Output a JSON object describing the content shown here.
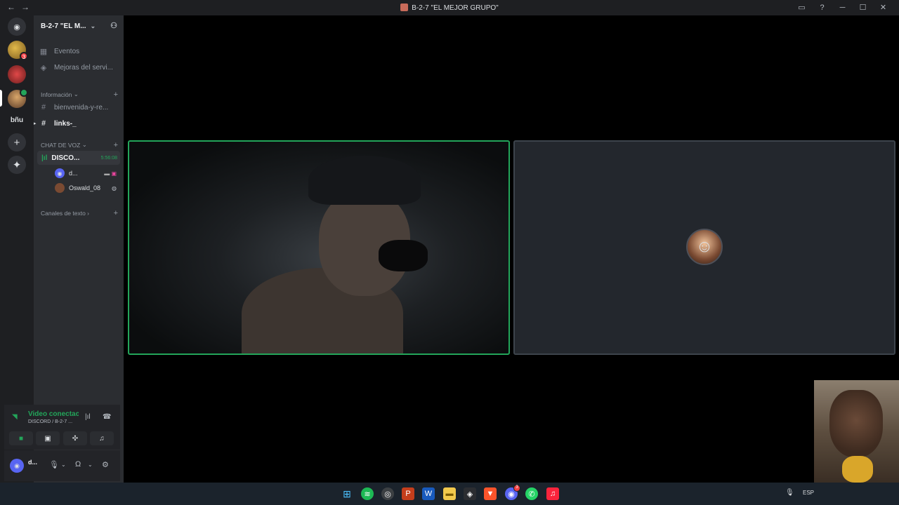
{
  "window": {
    "title": "B-2-7 \"EL MEJOR GRUPO\""
  },
  "servers": {
    "s1_badge": "3",
    "text_server": "bñu"
  },
  "server": {
    "name": "B-2-7 \"EL M..."
  },
  "channels": {
    "events": "Eventos",
    "boosts": "Mejoras del servi...",
    "cat_info": "Información",
    "ch_welcome": "bienvenida-y-re...",
    "ch_links": "links-_",
    "cat_voice": "CHAT DE VOZ",
    "voice_channel": "DISCO...",
    "voice_time": "5:56:08",
    "members": [
      {
        "name": "d..."
      },
      {
        "name": "Oswald_08"
      }
    ],
    "cat_text": "Canales de texto"
  },
  "voice_panel": {
    "status": "Video conectac",
    "subtitle": "DISCORD / B-2-7 ..."
  },
  "user_panel": {
    "name": "d..."
  },
  "taskbar": {
    "lang": "ESP",
    "discord_badge": "3"
  }
}
